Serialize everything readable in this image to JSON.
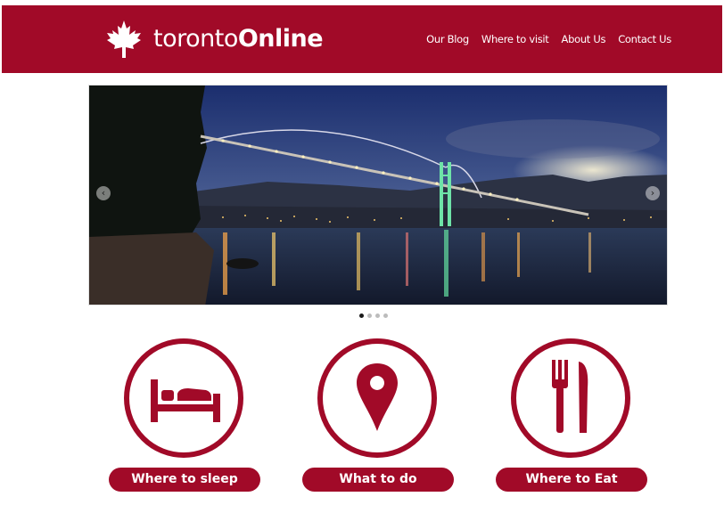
{
  "brand": {
    "name_light": "toronto",
    "name_bold": "Online",
    "icon": "maple-leaf-icon",
    "color": "#a10a28"
  },
  "nav": {
    "items": [
      "Our Blog",
      "Where to visit",
      "About Us",
      "Contact Us"
    ]
  },
  "slider": {
    "prev_icon": "chevron-left-icon",
    "next_icon": "chevron-right-icon",
    "prev_glyph": "‹",
    "next_glyph": "›",
    "slide_count": 4,
    "active_slide": 1
  },
  "features": [
    {
      "label": "Where to sleep",
      "icon": "bed-icon"
    },
    {
      "label": "What to do",
      "icon": "map-pin-icon"
    },
    {
      "label": "Where to Eat",
      "icon": "fork-knife-icon"
    }
  ]
}
